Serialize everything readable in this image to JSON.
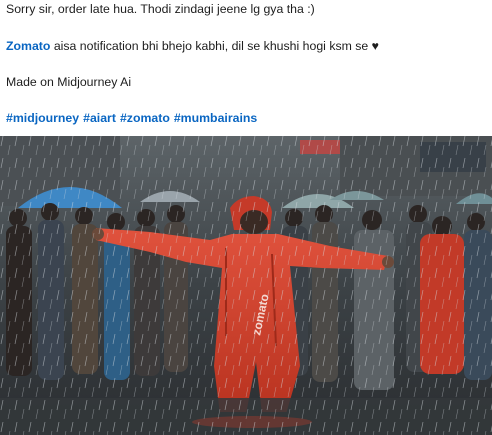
{
  "post": {
    "line1": "Sorry sir, order late hua. Thodi zindagi jeene lg gya tha :)",
    "mention": "Zomato",
    "line2_rest": " aisa notification bhi bhejo kabhi, dil se khushi hogi ksm se ♥",
    "line3": "Made on Midjourney Ai",
    "hashtags": [
      "#midjourney",
      "#aiart",
      "#zomato",
      "#mumbairains"
    ]
  },
  "image": {
    "raincoat_text": "zomato"
  },
  "colors": {
    "link": "#0a66c2",
    "raincoat": "#d8402f",
    "umbrella": "#3f88c5"
  }
}
